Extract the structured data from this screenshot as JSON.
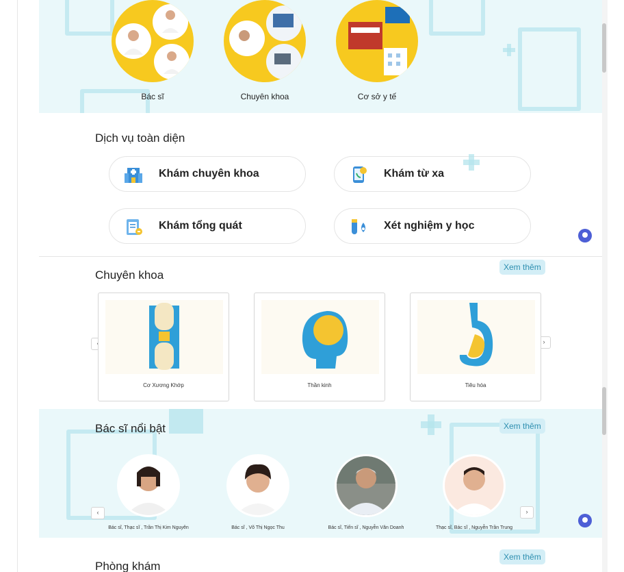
{
  "categories": [
    {
      "label": "Bác sĩ",
      "icon": "doctors-collage-icon"
    },
    {
      "label": "Chuyên khoa",
      "icon": "specialty-collage-icon"
    },
    {
      "label": "Cơ sở y tế",
      "icon": "facility-collage-icon"
    }
  ],
  "services": {
    "title": "Dịch vụ toàn diện",
    "items": [
      {
        "label": "Khám chuyên khoa",
        "icon": "hospital-icon"
      },
      {
        "label": "Khám từ xa",
        "icon": "phone-icon"
      },
      {
        "label": "Khám tổng quát",
        "icon": "clipboard-icon"
      },
      {
        "label": "Xét nghiệm y học",
        "icon": "test-tube-icon"
      }
    ]
  },
  "specialties": {
    "title": "Chuyên khoa",
    "more_label": "Xem thêm",
    "items": [
      {
        "label": "Cơ Xương Khớp",
        "icon": "bone-joint-icon"
      },
      {
        "label": "Thần kinh",
        "icon": "brain-icon"
      },
      {
        "label": "Tiêu hóa",
        "icon": "stomach-icon"
      }
    ]
  },
  "doctors": {
    "title": "Bác sĩ nổi bật",
    "more_label": "Xem thêm",
    "items": [
      {
        "name": "Bác sĩ, Thạc sĩ , Trần Thị Kim Nguyên"
      },
      {
        "name": "Bác sĩ , Võ Thị Ngọc Thu"
      },
      {
        "name": "Bác sĩ, Tiến sĩ , Nguyễn Văn Doanh"
      },
      {
        "name": "Thạc sĩ, Bác sĩ , Nguyễn Trần Trung"
      }
    ]
  },
  "clinics": {
    "title": "Phòng khám",
    "more_label": "Xem thêm"
  },
  "colors": {
    "accent": "#2e8fb0",
    "yellow": "#f7c91f",
    "cyan_bg": "#eaf8fa",
    "chat_bot": "#4d5fd6"
  }
}
